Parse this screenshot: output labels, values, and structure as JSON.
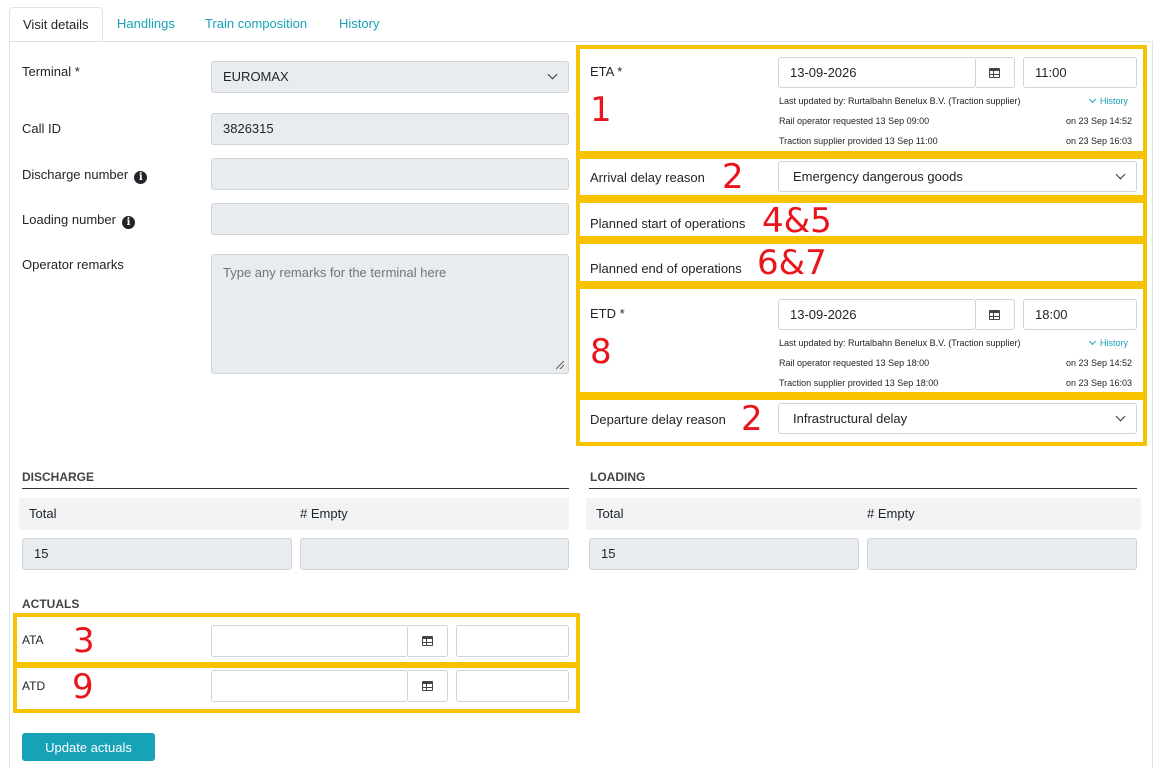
{
  "tabs": [
    {
      "label": "Visit details",
      "active": true
    },
    {
      "label": "Handlings"
    },
    {
      "label": "Train composition"
    },
    {
      "label": "History"
    }
  ],
  "left_form": {
    "terminal_label": "Terminal *",
    "terminal_value": "EUROMAX",
    "call_id_label": "Call ID",
    "call_id_value": "3826315",
    "discharge_number_label": "Discharge number",
    "discharge_number_value": "",
    "loading_number_label": "Loading number",
    "loading_number_value": "",
    "remarks_label": "Operator remarks",
    "remarks_placeholder": "Type any remarks for the terminal here"
  },
  "eta": {
    "label": "ETA *",
    "date": "13-09-2026",
    "time": "11:00",
    "last_updated": "Last updated by: Rurtalbahn Benelux B.V. (Traction supplier)",
    "history_link": "History",
    "line1": "Rail operator requested 13 Sep 09:00",
    "line1_when": "on 23 Sep 14:52",
    "line2": "Traction supplier provided 13 Sep 11:00",
    "line2_when": "on 23 Sep 16:03"
  },
  "arrival_delay": {
    "label": "Arrival delay reason",
    "value": "Emergency dangerous goods"
  },
  "planned_start_label": "Planned start of operations",
  "planned_end_label": "Planned end of operations",
  "etd": {
    "label": "ETD *",
    "date": "13-09-2026",
    "time": "18:00",
    "last_updated": "Last updated by: Rurtalbahn Benelux B.V. (Traction supplier)",
    "history_link": "History",
    "line1": "Rail operator requested 13 Sep 18:00",
    "line1_when": "on 23 Sep 14:52",
    "line2": "Traction supplier provided 13 Sep 18:00",
    "line2_when": "on 23 Sep 16:03"
  },
  "departure_delay": {
    "label": "Departure delay reason",
    "value": "Infrastructural delay"
  },
  "discharge": {
    "title": "DISCHARGE",
    "total_label": "Total",
    "empty_label": "# Empty",
    "total_value": "15",
    "empty_value": ""
  },
  "loading": {
    "title": "LOADING",
    "total_label": "Total",
    "empty_label": "# Empty",
    "total_value": "15",
    "empty_value": ""
  },
  "actuals": {
    "title": "ACTUALS",
    "ata_label": "ATA",
    "atd_label": "ATD"
  },
  "update_button": "Update actuals",
  "annotations": {
    "n1": "1",
    "n2a": "2",
    "n2b": "2",
    "n3": "3",
    "n45": "4&5",
    "n67": "6&7",
    "n8": "8",
    "n9": "9"
  },
  "colors": {
    "accent": "#17a2b8",
    "highlight_box": "#f7c300",
    "annotation_text": "#e8161c"
  }
}
